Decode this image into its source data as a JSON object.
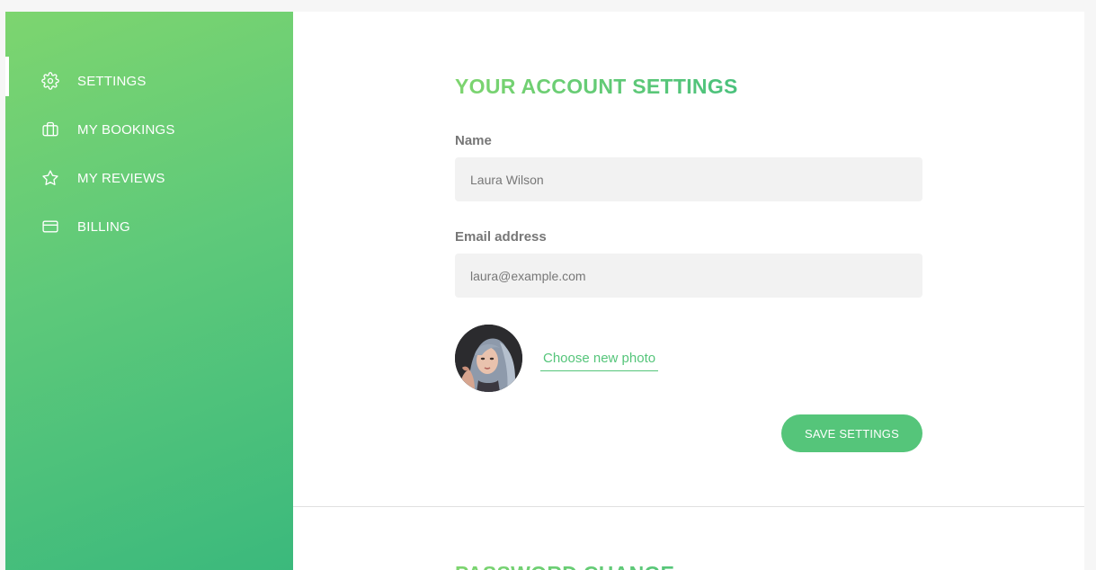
{
  "sidebar": {
    "items": [
      {
        "label": "SETTINGS",
        "icon": "settings-icon",
        "active": true
      },
      {
        "label": "MY BOOKINGS",
        "icon": "briefcase-icon",
        "active": false
      },
      {
        "label": "MY REVIEWS",
        "icon": "star-icon",
        "active": false
      },
      {
        "label": "BILLING",
        "icon": "credit-card-icon",
        "active": false
      }
    ]
  },
  "account": {
    "title": "YOUR ACCOUNT SETTINGS",
    "name_label": "Name",
    "name_value": "Laura Wilson",
    "email_label": "Email address",
    "email_value": "laura@example.com",
    "photo_link": "Choose new photo",
    "save_label": "SAVE SETTINGS"
  },
  "password": {
    "title": "PASSWORD CHANGE"
  },
  "colors": {
    "accent": "#55c57a",
    "gradient_start": "#7ed56f",
    "gradient_end": "#28b485",
    "input_bg": "#f2f2f2"
  }
}
